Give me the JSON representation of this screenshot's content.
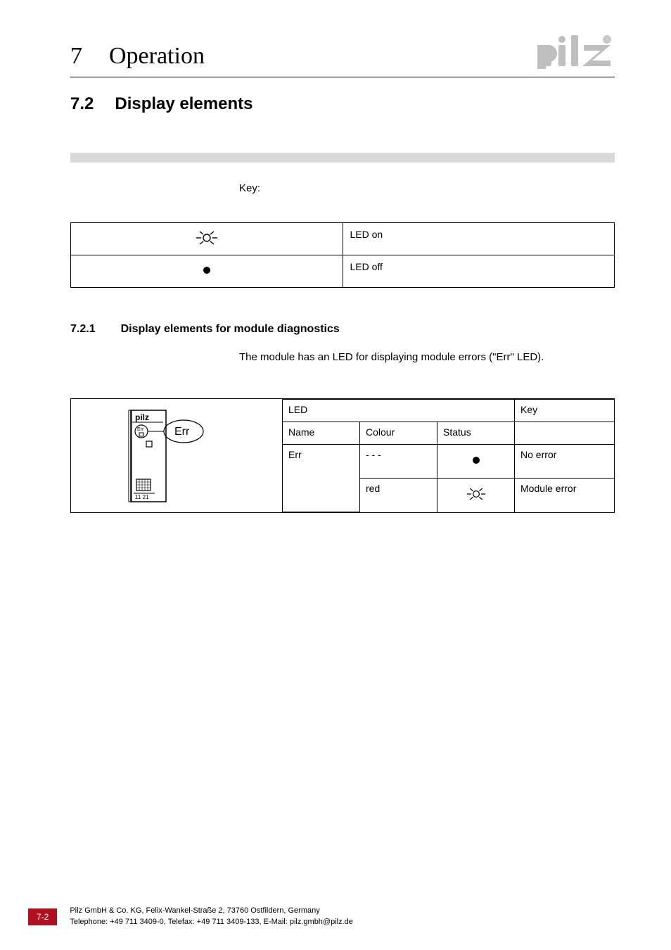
{
  "header": {
    "chapter_number": "7",
    "chapter_title": "Operation"
  },
  "section": {
    "number": "7.2",
    "title": "Display elements"
  },
  "key_label": "Key:",
  "key_table": {
    "rows": [
      {
        "symbol": "led-on",
        "label": "LED on"
      },
      {
        "symbol": "led-off",
        "label": "LED off"
      }
    ]
  },
  "subsection": {
    "number": "7.2.1",
    "title": "Display elements for module diagnostics"
  },
  "module_text": "The module has an LED for displaying module errors (\"Err\" LED).",
  "diag_table": {
    "header": {
      "led": "LED",
      "name": "Name",
      "colour": "Colour",
      "status": "Status",
      "key": "Key"
    },
    "rows": [
      {
        "name": "Err",
        "colour": "- - -",
        "status": "led-off",
        "key": "No error"
      },
      {
        "name": "",
        "colour": "red",
        "status": "led-on",
        "key": "Module error"
      }
    ]
  },
  "module_callout": {
    "label": "Err",
    "terminals": "11 21"
  },
  "footer": {
    "page": "7-2",
    "line1": "Pilz GmbH & Co. KG, Felix-Wankel-Straße 2, 73760 Ostfildern, Germany",
    "line2": "Telephone: +49 711 3409-0, Telefax: +49 711 3409-133, E-Mail: pilz.gmbh@pilz.de"
  }
}
